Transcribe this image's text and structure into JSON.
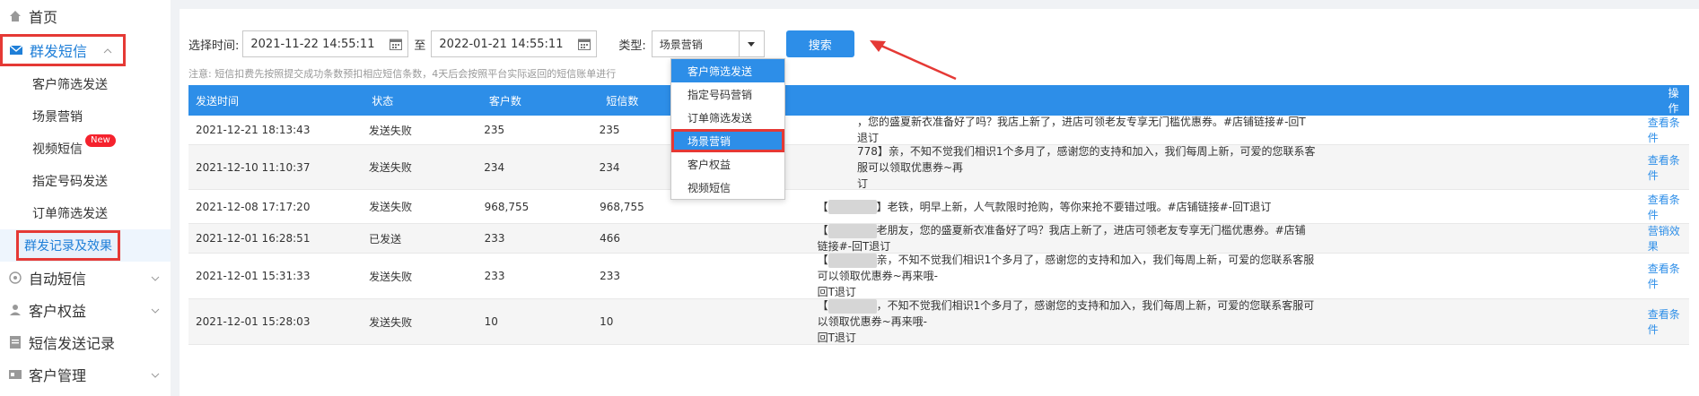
{
  "sidebar": {
    "home": "首页",
    "group_sms": "群发短信",
    "sub": [
      "客户筛选发送",
      "场景营销",
      "视频短信",
      "指定号码发送",
      "订单筛选发送",
      "群发记录及效果"
    ],
    "new_badge": "New",
    "auto_sms": "自动短信",
    "customer_rights": "客户权益",
    "sms_records": "短信发送记录",
    "customer_mgmt": "客户管理"
  },
  "filter": {
    "time_label": "选择时间:",
    "start": "2021-11-22  14:55:11",
    "to": "至",
    "end": "2022-01-21  14:55:11",
    "type_label": "类型:",
    "type_value": "场景营销",
    "search": "搜索"
  },
  "notice": "注意:  短信扣费先按照提交成功条数预扣相应短信条数，4天后会按照平台实际返回的短信账单进行",
  "dropdown": [
    "客户筛选发送",
    "指定号码营销",
    "订单筛选发送",
    "场景营销",
    "客户权益",
    "视频短信"
  ],
  "table": {
    "headers": [
      "发送时间",
      "状态",
      "客户数",
      "短信数",
      "",
      "",
      "操作"
    ],
    "rows": [
      {
        "time": "2021-12-21  18:13:43",
        "status": "发送失败",
        "customers": "235",
        "sms": "235",
        "pre": "",
        "content": "，您的盛夏新衣准备好了吗？我店上新了，进店可领老友专享无门槛优惠券。#店铺链接#-回T退订",
        "content2": "",
        "op": "查看条件"
      },
      {
        "time": "2021-12-10  11:10:37",
        "status": "发送失败",
        "customers": "234",
        "sms": "234",
        "pre": "",
        "content": "778】亲，不知不觉我们相识1个多月了，感谢您的支持和加入，我们每周上新，可爱的您联系客服可以领取优惠券~再",
        "content2": "订",
        "op": "查看条件"
      },
      {
        "time": "2021-12-08  17:17:20",
        "status": "发送失败",
        "customers": "968,755",
        "sms": "968,755",
        "pre": "【",
        "content": "】老铁，明早上新，人气款限时抢购，等你来抢不要错过哦。#店铺链接#-回T退订",
        "content2": "",
        "op": "查看条件"
      },
      {
        "time": "2021-12-01  16:28:51",
        "status": "已发送",
        "customers": "233",
        "sms": "466",
        "pre": "【",
        "content": "老朋友，您的盛夏新衣准备好了吗？我店上新了，进店可领老友专享无门槛优惠券。#店铺链接#-回T退订",
        "content2": "",
        "op": "营销效果"
      },
      {
        "time": "2021-12-01  15:31:33",
        "status": "发送失败",
        "customers": "233",
        "sms": "233",
        "pre": "【",
        "content": "亲，不知不觉我们相识1个多月了，感谢您的支持和加入，我们每周上新，可爱的您联系客服可以领取优惠券~再来哦-",
        "content2": "回T退订",
        "op": "查看条件"
      },
      {
        "time": "2021-12-01  15:28:03",
        "status": "发送失败",
        "customers": "10",
        "sms": "10",
        "pre": "【",
        "content": "，不知不觉我们相识1个多月了，感谢您的支持和加入，我们每周上新，可爱的您联系客服可以领取优惠券~再来哦-",
        "content2": "回T退订",
        "op": "查看条件"
      }
    ]
  },
  "colors": {
    "accent": "#2d8ee8",
    "highlight": "#e53935",
    "active_text": "#1f7fd8"
  }
}
